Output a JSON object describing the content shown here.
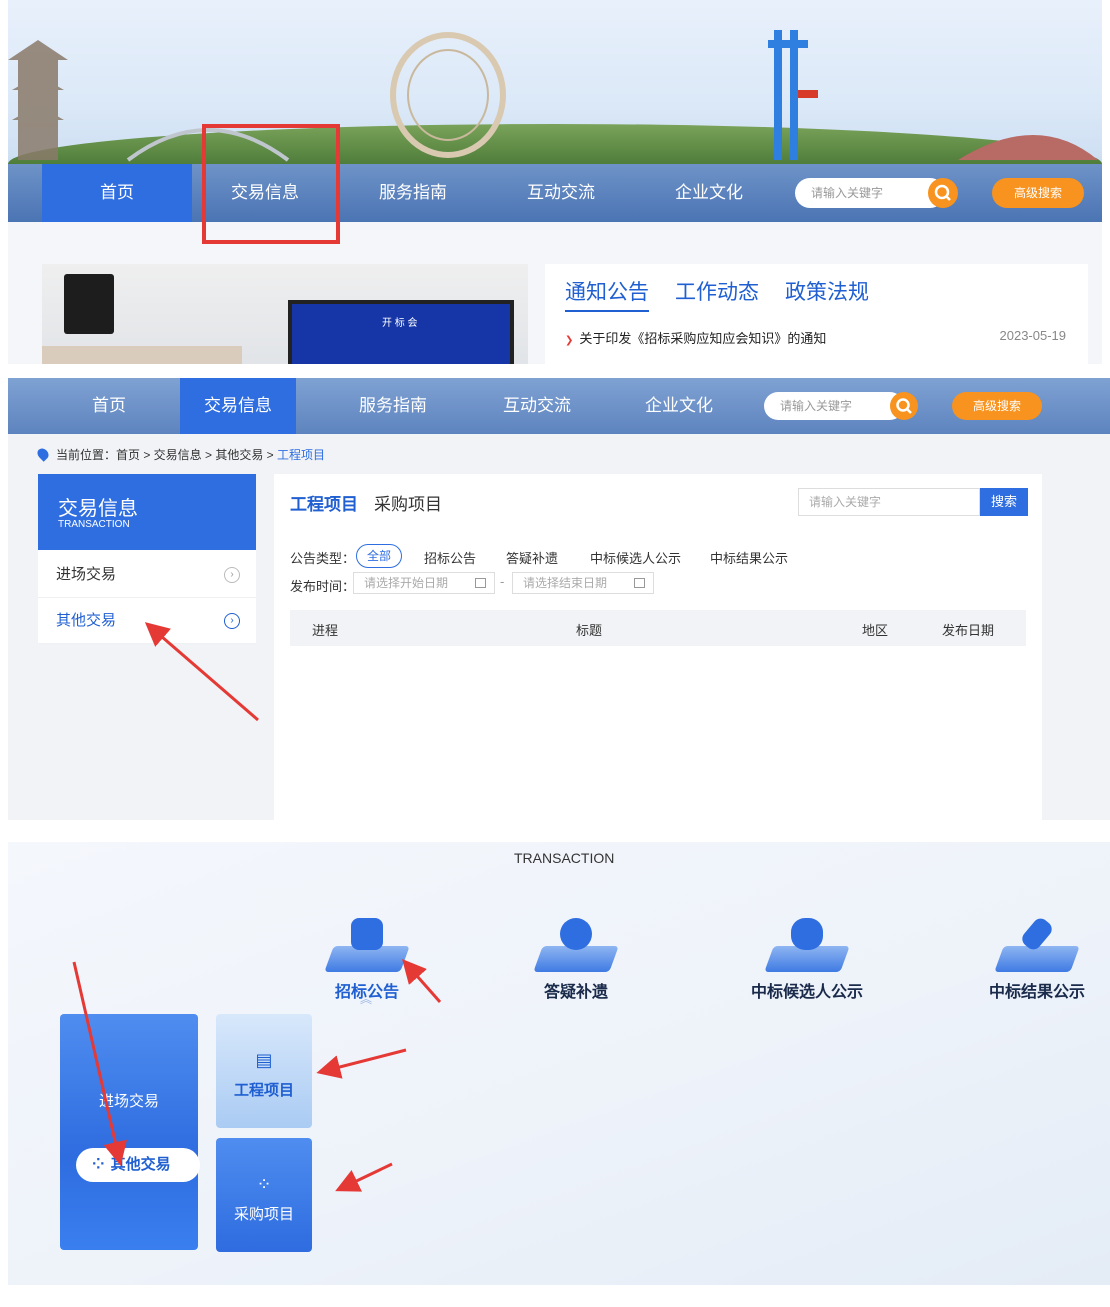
{
  "panel1": {
    "nav": [
      "首页",
      "交易信息",
      "服务指南",
      "互动交流",
      "企业文化"
    ],
    "search_placeholder": "请输入关键字",
    "advanced_search": "高级搜索",
    "photo_caption": "开 标 会",
    "news_tabs": [
      "通知公告",
      "工作动态",
      "政策法规"
    ],
    "news_item": {
      "title": "关于印发《招标采购应知应会知识》的通知",
      "date": "2023-05-19"
    }
  },
  "panel2": {
    "nav": [
      "首页",
      "交易信息",
      "服务指南",
      "互动交流",
      "企业文化"
    ],
    "search_placeholder": "请输入关键字",
    "advanced_search": "高级搜索",
    "breadcrumb": {
      "prefix": "当前位置：首页 > 交易信息 > 其他交易 > ",
      "current": "工程项目"
    },
    "sidebar": {
      "title": "交易信息",
      "subtitle": "TRANSACTION",
      "items": [
        "进场交易",
        "其他交易"
      ]
    },
    "tabs": [
      "工程项目",
      "采购项目"
    ],
    "keyword_placeholder": "请输入关键字",
    "search_button": "搜索",
    "filter": {
      "type_label": "公告类型：",
      "types": [
        "全部",
        "招标公告",
        "答疑补遗",
        "中标候选人公示",
        "中标结果公示"
      ],
      "time_label": "发布时间：",
      "start_placeholder": "请选择开始日期",
      "separator": "-",
      "end_placeholder": "请选择结束日期"
    },
    "table_headers": [
      "进程",
      "标题",
      "地区",
      "发布日期"
    ]
  },
  "panel3": {
    "heading": "TRANSACTION",
    "categories": [
      "招标公告",
      "答疑补遗",
      "中标候选人公示",
      "中标结果公示"
    ],
    "left_card": {
      "label": "进场交易",
      "pill": "其他交易"
    },
    "tiles": [
      "工程项目",
      "采购项目"
    ]
  },
  "colors": {
    "primary": "#2f6ee0",
    "accent": "#f7931e",
    "highlight_red": "#e53935"
  }
}
